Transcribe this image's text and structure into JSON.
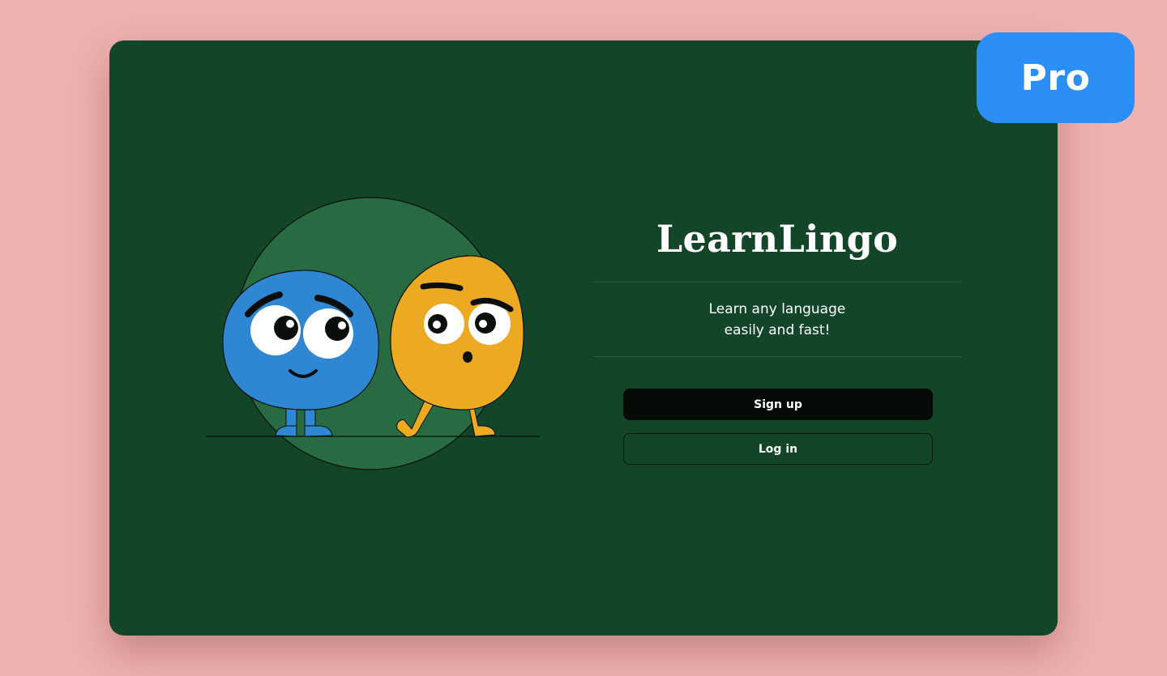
{
  "badge": {
    "label": "Pro"
  },
  "brand": {
    "name": "LearnLingo"
  },
  "tagline": {
    "line1": "Learn any language",
    "line2": "easily and fast!"
  },
  "actions": {
    "signup_label": "Sign up",
    "login_label": "Log in"
  },
  "colors": {
    "background": "#eeb2b2",
    "card": "#134628",
    "circle": "#286b43",
    "blue_character": "#2f86d3",
    "orange_character": "#ecaa22",
    "badge": "#2b8ff7",
    "signup_button": "#060a07"
  }
}
